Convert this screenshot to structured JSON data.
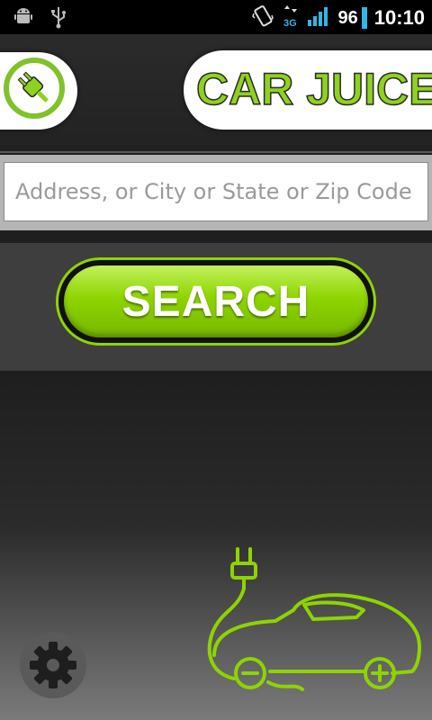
{
  "status_bar": {
    "left_icons": [
      "android-debug-icon",
      "usb-icon"
    ],
    "right_icons": [
      "vibrate-icon",
      "3g-data-icon",
      "signal-icon",
      "battery-icon"
    ],
    "battery_level": "96",
    "time": "10:10",
    "accent_color": "#33b5e5"
  },
  "header": {
    "logo_icon": "plug-badge-icon",
    "title": "CAR JUICE",
    "brand_color": "#8fd11f"
  },
  "search": {
    "placeholder": "Address, or City or State or Zip Code",
    "value": "",
    "button_label": "SEARCH"
  },
  "footer": {
    "settings_icon": "gear-icon",
    "illustration": "electric-car-plug-illustration"
  }
}
